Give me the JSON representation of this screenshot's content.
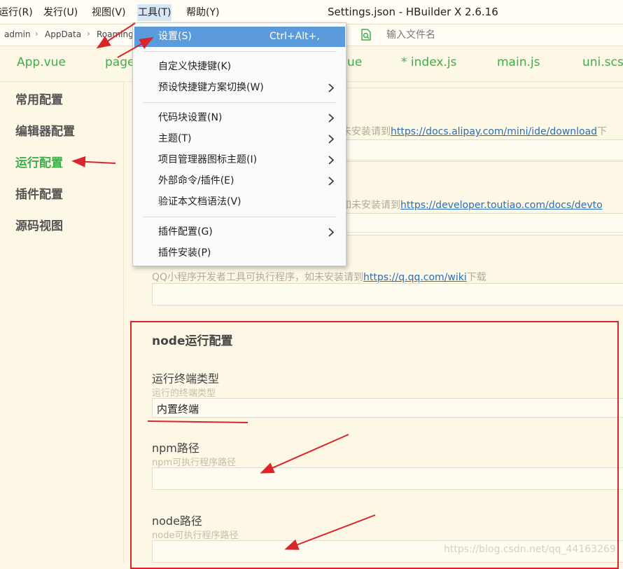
{
  "menubar": {
    "items": [
      "运行(R)",
      "发行(U)",
      "视图(V)",
      "工具(T)",
      "帮助(Y)"
    ],
    "window_title": "Settings.json - HBuilder X 2.6.16"
  },
  "breadcrumb": {
    "items": [
      "admin",
      "AppData",
      "Roaming"
    ],
    "separator": "›",
    "file_search_placeholder": "输入文件名"
  },
  "tabs": [
    "App.vue",
    "page",
    "vue",
    "* index.js",
    "main.js",
    "uni.scss"
  ],
  "sidebar": {
    "items": [
      {
        "label": "常用配置"
      },
      {
        "label": "编辑器配置"
      },
      {
        "label": "运行配置",
        "active": true
      },
      {
        "label": "插件配置"
      },
      {
        "label": "源码视图"
      }
    ]
  },
  "content": {
    "alipay_desc_prefix": "未安装请到",
    "alipay_link": "https://docs.alipay.com/mini/ide/download",
    "alipay_desc_suffix": "下",
    "toutiao_desc_prefix": "如未安装请到",
    "toutiao_link": "https://developer.toutiao.com/docs/devto",
    "qq_desc_prefix": "QQ小程序开发者工具可执行程序，如未安装请到",
    "qq_link": "https://q.qq.com/wiki",
    "qq_desc_suffix": "下载",
    "node_section": {
      "title": "node运行配置",
      "terminal_label": "运行终端类型",
      "terminal_hint": "运行的终端类型",
      "terminal_value": "内置终端",
      "npm_label": "npm路径",
      "npm_hint": "npm可执行程序路径",
      "npm_value": "",
      "node_label": "node路径",
      "node_hint": "node可执行程序路径",
      "node_value": ""
    }
  },
  "tools_menu": {
    "items": [
      {
        "label": "设置(S)",
        "shortcut": "Ctrl+Alt+,",
        "highlighted": true
      },
      {
        "label": "自定义快捷键(K)"
      },
      {
        "label": "预设快捷键方案切换(W)",
        "submenu": true
      },
      {
        "label": "代码块设置(N)",
        "submenu": true
      },
      {
        "label": "主题(T)",
        "submenu": true
      },
      {
        "label": "项目管理器图标主题(I)",
        "submenu": true
      },
      {
        "label": "外部命令/插件(E)",
        "submenu": true
      },
      {
        "label": "验证本文档语法(V)"
      },
      {
        "label": "插件配置(G)",
        "submenu": true
      },
      {
        "label": "插件安装(P)"
      }
    ]
  },
  "watermark": "https://blog.csdn.net/qq_44163269",
  "colors": {
    "accent_green": "#3eaf4b",
    "menu_highlight": "#5b9bdb",
    "annotation_red": "#d9262b",
    "link_blue": "#2a6fb8",
    "background": "#fdf7e6"
  },
  "icons": [
    "chevron-right-icon",
    "file-search-icon"
  ]
}
